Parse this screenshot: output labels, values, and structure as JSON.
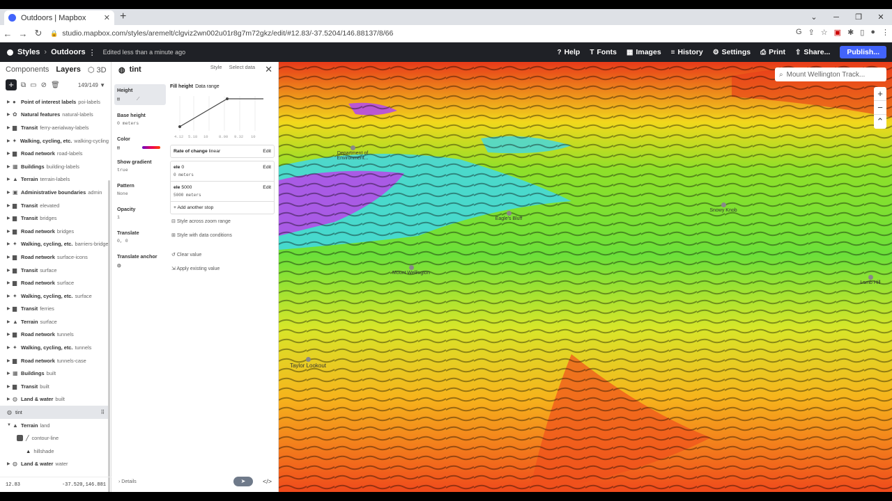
{
  "browser": {
    "tab_title": "Outdoors | Mapbox",
    "url": "studio.mapbox.com/styles/aremelt/clgviz2wn002u01r8g7m72gkz/edit/#12.83/-37.5204/146.88137/8/66"
  },
  "app": {
    "styles": "Styles",
    "style_name": "Outdoors",
    "edited": "Edited less than a minute ago",
    "menu": [
      "Help",
      "Fonts",
      "Images",
      "History",
      "Settings",
      "Print",
      "Share...",
      "Publish..."
    ]
  },
  "left": {
    "tabs": [
      "Components",
      "Layers",
      "3D"
    ],
    "count": "149/149",
    "layers": [
      {
        "name": "Point of interest labels",
        "sub": "poi-labels",
        "icon": "pin-icon"
      },
      {
        "name": "Natural features",
        "sub": "natural-labels",
        "icon": "leaf-icon"
      },
      {
        "name": "Transit",
        "sub": "ferry-aerialway-labels",
        "icon": "bus-icon"
      },
      {
        "name": "Walking, cycling, etc.",
        "sub": "walking-cycling",
        "icon": "walker-icon"
      },
      {
        "name": "Road network",
        "sub": "road-labels",
        "icon": "road-icon"
      },
      {
        "name": "Buildings",
        "sub": "building-labels",
        "icon": "building-icon"
      },
      {
        "name": "Terrain",
        "sub": "terrain-labels",
        "icon": "terrain-icon"
      },
      {
        "name": "Administrative boundaries",
        "sub": "admin",
        "icon": "flag-icon"
      },
      {
        "name": "Transit",
        "sub": "elevated",
        "icon": "bus-icon"
      },
      {
        "name": "Transit",
        "sub": "bridges",
        "icon": "bus-icon"
      },
      {
        "name": "Road network",
        "sub": "bridges",
        "icon": "road-icon"
      },
      {
        "name": "Walking, cycling, etc.",
        "sub": "barriers-bridge",
        "icon": "walker-icon"
      },
      {
        "name": "Road network",
        "sub": "surface-icons",
        "icon": "road-icon"
      },
      {
        "name": "Transit",
        "sub": "surface",
        "icon": "bus-icon"
      },
      {
        "name": "Road network",
        "sub": "surface",
        "icon": "road-icon"
      },
      {
        "name": "Walking, cycling, etc.",
        "sub": "surface",
        "icon": "walker-icon"
      },
      {
        "name": "Transit",
        "sub": "ferries",
        "icon": "bus-icon"
      },
      {
        "name": "Terrain",
        "sub": "surface",
        "icon": "terrain-icon"
      },
      {
        "name": "Road network",
        "sub": "tunnels",
        "icon": "road-icon"
      },
      {
        "name": "Walking, cycling, etc.",
        "sub": "tunnels",
        "icon": "walker-icon"
      },
      {
        "name": "Road network",
        "sub": "tunnels-case",
        "icon": "road-icon"
      },
      {
        "name": "Buildings",
        "sub": "built",
        "icon": "building-icon"
      },
      {
        "name": "Transit",
        "sub": "built",
        "icon": "bus-icon"
      },
      {
        "name": "Land & water",
        "sub": "built",
        "icon": "globe-icon"
      }
    ],
    "selected": "tint",
    "terrain_group": {
      "name": "Terrain",
      "sub": "land"
    },
    "children": [
      "contour-line",
      "hillshade"
    ],
    "after": {
      "name": "Land & water",
      "sub": "water"
    },
    "zoom": "12.83",
    "coords": "-37.520,146.881"
  },
  "editor": {
    "title": "tint",
    "tabs": [
      "Style",
      "Select data"
    ],
    "props": [
      {
        "name": "Height",
        "value": ""
      },
      {
        "name": "Base height",
        "value": "0 meters"
      },
      {
        "name": "Color",
        "value": ""
      },
      {
        "name": "Show gradient",
        "value": "true"
      },
      {
        "name": "Pattern",
        "value": "None"
      },
      {
        "name": "Opacity",
        "value": "1"
      },
      {
        "name": "Translate",
        "value": "0, 0"
      },
      {
        "name": "Translate anchor",
        "value": ""
      }
    ],
    "fill_height": "Fill height",
    "data_range": "Data range",
    "ticks": [
      "4.12",
      "5.18",
      "10",
      "8.00",
      "9.32",
      "10"
    ],
    "rate": {
      "label": "Rate of change",
      "value": "linear",
      "edit": "Edit"
    },
    "stops": [
      {
        "key": "ele",
        "val": "0",
        "out": "0 meters"
      },
      {
        "key": "ele",
        "val": "5000",
        "out": "5000 meters"
      }
    ],
    "add_stop": "Add another stop",
    "zoom_range": "Style across zoom range",
    "data_conditions": "Style with data conditions",
    "clear": "Clear value",
    "apply": "Apply existing value",
    "details": "Details"
  },
  "map": {
    "search": "Mount Wellington Track...",
    "pois": [
      "Department of Environment...",
      "Mount Wellington",
      "Eagle's Bluff",
      "Snowy Knob",
      "Taylor Lookout",
      "Lamb Hill"
    ]
  },
  "colors": {
    "accent": "#4264fb",
    "dark": "#1f2126"
  }
}
